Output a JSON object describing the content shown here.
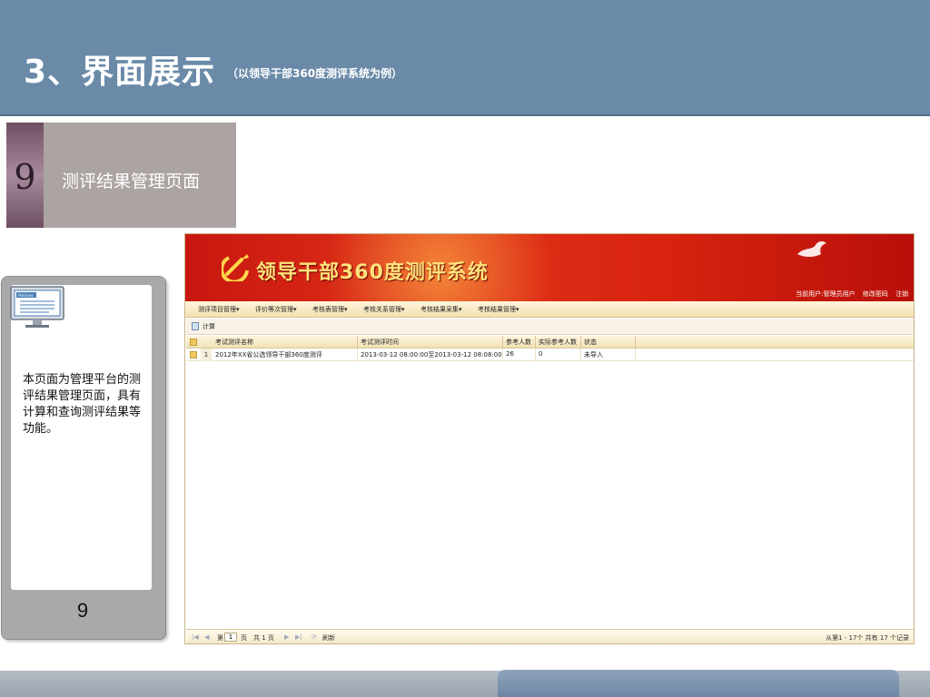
{
  "header": {
    "title": "3、界面展示",
    "subtitle": "（以领导干部360度测评系统为例）"
  },
  "section": {
    "number": "9",
    "title": "测评结果管理页面"
  },
  "card": {
    "icon": "policies-monitor-icon",
    "icon_label": "Policies",
    "description": "本页面为管理平台的测评结果管理页面，具有计算和查询测评结果等功能。",
    "page_number": "9"
  },
  "app": {
    "banner_title": "领导干部360度测评系统",
    "user_label": "当前用户:管理员用户",
    "change_password": "修改密码",
    "logout": "注销",
    "menu": [
      {
        "label": "测评项目管理▾"
      },
      {
        "label": "评价等次管理▾"
      },
      {
        "label": "考核表管理▾"
      },
      {
        "label": "考核关系管理▾"
      },
      {
        "label": "考核结果采集▾"
      },
      {
        "label": "考核结果管理▾"
      }
    ],
    "toolbar": {
      "calculate": "计算"
    },
    "table": {
      "columns": [
        "考试测评名称",
        "考试测评时间",
        "参考人数",
        "实际参考人数",
        "状态"
      ],
      "rows": [
        {
          "no": "1",
          "name": "2012年XX省公选领导干部360度测评",
          "time": "2013-03-12 08:00:00至2013-03-12 08:08:00",
          "participants": "26",
          "actual": "0",
          "status": "未导入"
        }
      ]
    },
    "pager": {
      "page_prefix": "第",
      "page_value": "1",
      "page_suffix": "页",
      "total_pages": "共 1 页",
      "refresh": "刷新",
      "summary": "从第1 - 17个 共有 17 个记录"
    }
  },
  "colors": {
    "header_bg": "#6a8aa8",
    "banner_red": "#d8240f",
    "banner_title": "#ffe27a"
  }
}
